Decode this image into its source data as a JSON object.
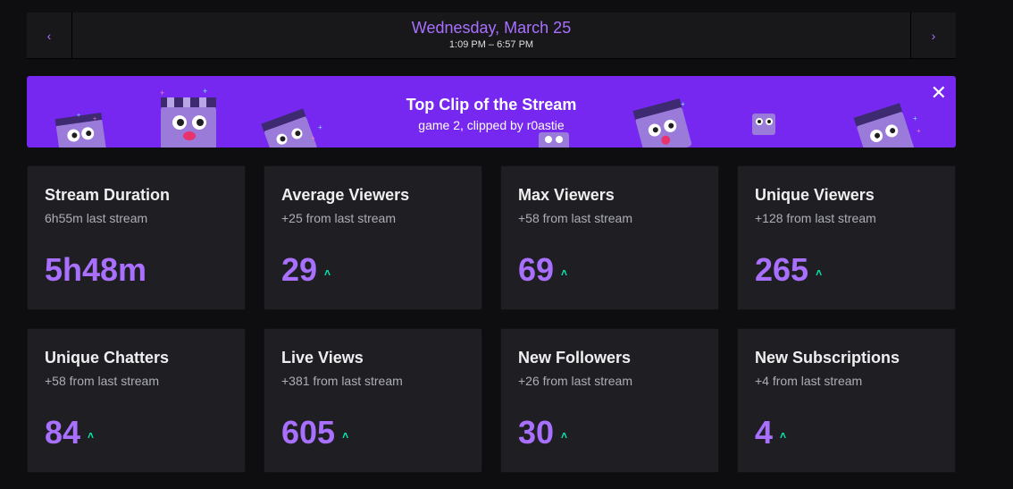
{
  "date_nav": {
    "prev_icon": "chevron-left-icon",
    "next_icon": "chevron-right-icon",
    "prev_glyph": "‹",
    "next_glyph": "›",
    "title": "Wednesday, March 25",
    "time_range": "1:09 PM – 6:57 PM"
  },
  "clip_banner": {
    "title": "Top Clip of the Stream",
    "subtitle": "game 2, clipped by r0astie",
    "close_glyph": "✕",
    "background": "#7728f0"
  },
  "colors": {
    "accent": "#a970ff",
    "trend_up": "#00f0b4",
    "card_bg": "#1f1f23",
    "page_bg": "#0e0e10"
  },
  "stats": [
    {
      "title": "Stream Duration",
      "subtitle": "6h55m last stream",
      "value": "5h48m",
      "trend": ""
    },
    {
      "title": "Average Viewers",
      "subtitle": "+25 from last stream",
      "value": "29",
      "trend": "˄"
    },
    {
      "title": "Max Viewers",
      "subtitle": "+58 from last stream",
      "value": "69",
      "trend": "˄"
    },
    {
      "title": "Unique Viewers",
      "subtitle": "+128 from last stream",
      "value": "265",
      "trend": "˄"
    },
    {
      "title": "Unique Chatters",
      "subtitle": "+58 from last stream",
      "value": "84",
      "trend": "˄"
    },
    {
      "title": "Live Views",
      "subtitle": "+381 from last stream",
      "value": "605",
      "trend": "˄"
    },
    {
      "title": "New Followers",
      "subtitle": "+26 from last stream",
      "value": "30",
      "trend": "˄"
    },
    {
      "title": "New Subscriptions",
      "subtitle": "+4 from last stream",
      "value": "4",
      "trend": "˄"
    }
  ]
}
